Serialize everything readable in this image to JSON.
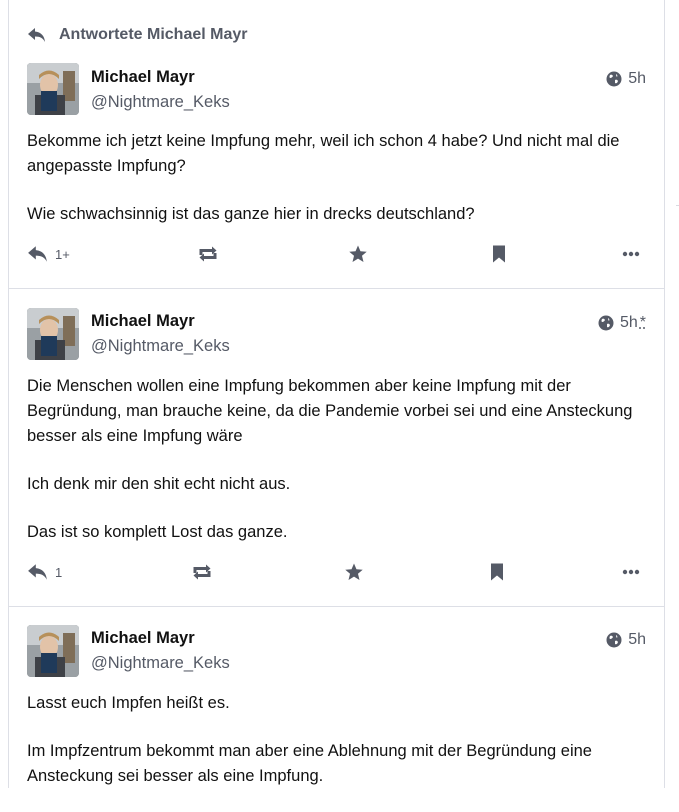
{
  "thread": {
    "reply_prepend": "Antwortete Michael Mayr"
  },
  "posts": [
    {
      "author": "Michael Mayr",
      "handle": "@Nightmare_Keks",
      "time": "5h",
      "edited_marker": "",
      "paragraphs": [
        "Bekomme ich jetzt keine Impfung mehr, weil ich schon 4 habe? Und nicht mal die angepasste Impfung?",
        "Wie schwachsinnig ist das ganze hier in drecks deutschland?"
      ],
      "reply_count": "1+"
    },
    {
      "author": "Michael Mayr",
      "handle": "@Nightmare_Keks",
      "time": "5h",
      "edited_marker": "*",
      "paragraphs": [
        "Die Menschen wollen eine Impfung bekommen aber keine Impfung mit der Begründung, man brauche keine, da die Pandemie vorbei sei und eine Ansteckung besser als eine Impfung wäre",
        "Ich denk mir den shit echt nicht aus.",
        "Das ist so komplett Lost das ganze."
      ],
      "reply_count": "1"
    },
    {
      "author": "Michael Mayr",
      "handle": "@Nightmare_Keks",
      "time": "5h",
      "edited_marker": "",
      "paragraphs": [
        "Lasst euch Impfen heißt es.",
        "Im Impfzentrum bekommt man aber eine Ablehnung mit der Begründung eine Ansteckung sei besser als eine Impfung."
      ]
    }
  ],
  "icons": {
    "reply": "reply-icon",
    "boost": "retweet-icon",
    "favourite": "star-icon",
    "bookmark": "bookmark-icon",
    "more": "ellipsis-icon",
    "visibility": "globe-icon"
  },
  "colors": {
    "muted": "#555a66",
    "border": "#dddfe6",
    "text": "#111111"
  }
}
